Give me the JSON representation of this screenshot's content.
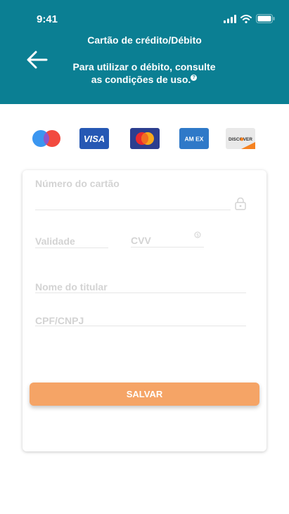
{
  "status_bar": {
    "time": "9:41"
  },
  "header": {
    "title": "Cartão de crédito/Débito",
    "subtitle_line1": "Para utilizar o débito, consulte",
    "subtitle_line2": "as condições de uso.",
    "help_glyph": "?",
    "background_color": "#0b7f93"
  },
  "brands": {
    "visa": "VISA",
    "amex": "AM EX",
    "discover": "DISCOVER"
  },
  "form": {
    "card_number_label": "Número do cartão",
    "validity_label": "Validade",
    "cvv_label": "CVV",
    "holder_name_label": "Nome do titular",
    "document_label": "CPF/CNPJ",
    "save_button": "SALVAR",
    "button_color": "#f5a466"
  }
}
